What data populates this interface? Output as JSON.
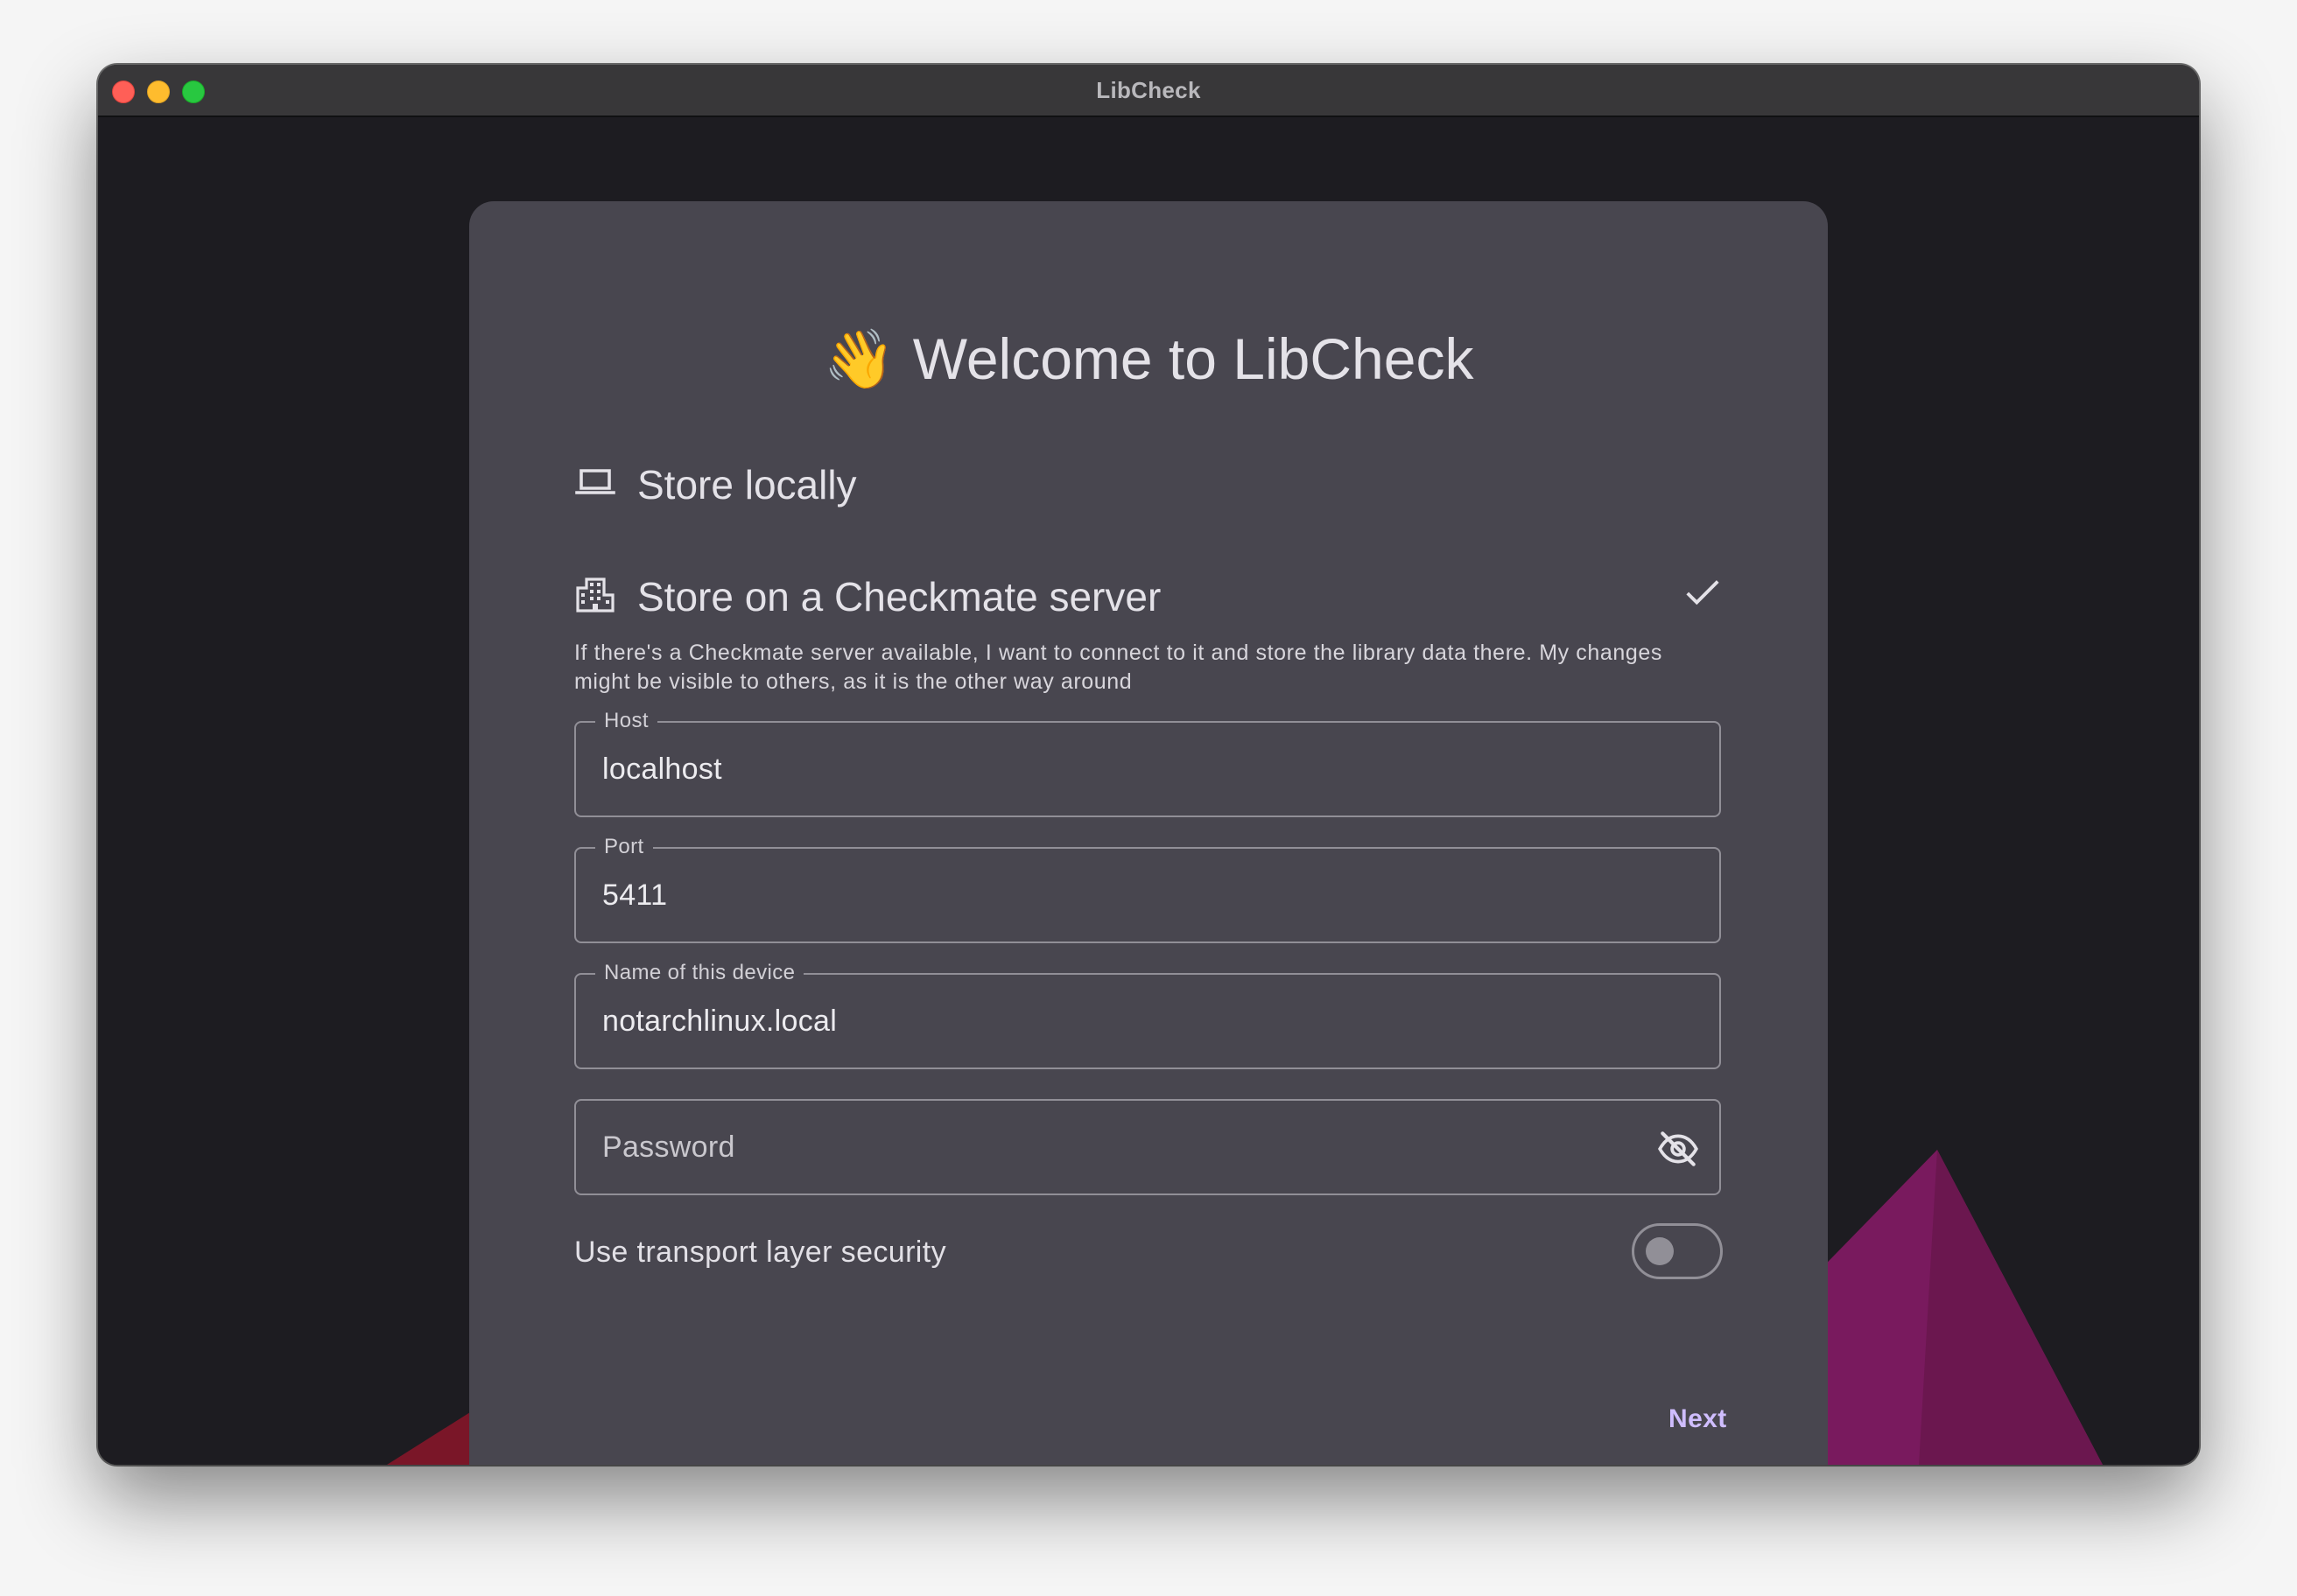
{
  "window": {
    "title": "LibCheck"
  },
  "welcome": {
    "emoji": "👋",
    "title": "Welcome to LibCheck"
  },
  "options": {
    "local": {
      "icon": "laptop-icon",
      "label": "Store locally"
    },
    "server": {
      "icon": "building-icon",
      "label": "Store on a Checkmate server",
      "selected_icon": "checkmark-icon",
      "description": "If there's a Checkmate server available, I want to connect to it and store the library data there. My changes might be visible to others, as it is the other way around"
    }
  },
  "form": {
    "host": {
      "label": "Host",
      "value": "localhost"
    },
    "port": {
      "label": "Port",
      "value": "5411"
    },
    "device": {
      "label": "Name of this device",
      "value": "notarchlinux.local"
    },
    "password": {
      "placeholder": "Password",
      "visibility_icon": "eye-off-icon"
    },
    "tls": {
      "label": "Use transport layer security",
      "enabled": false
    }
  },
  "actions": {
    "next_label": "Next"
  },
  "colors": {
    "window_bg": "#1d1c21",
    "card_bg": "#48464f",
    "accent": "#cfbdfe",
    "outline": "#918f97"
  }
}
